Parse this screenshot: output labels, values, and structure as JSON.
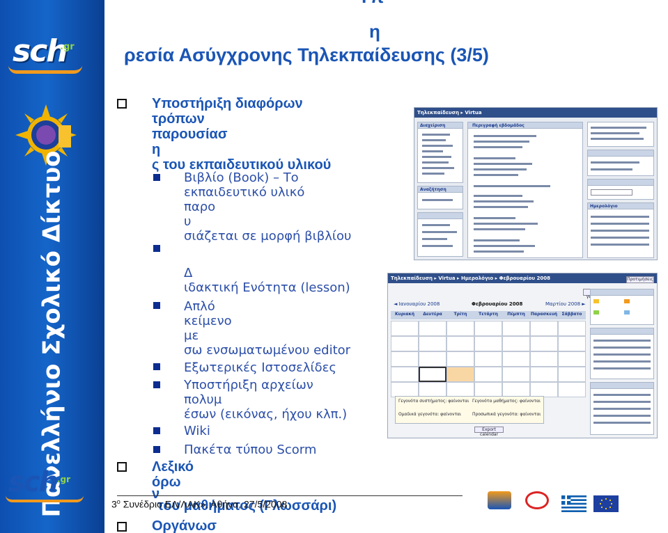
{
  "title": {
    "top": "Υπ",
    "mid": "η",
    "main": "ρεσία Ασύγχρονης Τηλεκπαίδευσης (3/5)"
  },
  "sidebar": {
    "logo": "sch",
    "logo_suffix": ".gr",
    "vertical_text": "Πανελλήνιο Σχολικό Δίκτυο"
  },
  "outline": [
    {
      "level": 1,
      "lines": [
        "Υποστήριξη διαφόρων",
        "τρόπων",
        "παρουσίασ",
        "η",
        "ς του εκπαιδευτικού υλικού"
      ]
    },
    {
      "level": 2,
      "lines": [
        "Βιβλίο (Book) – Το",
        "εκπαιδευτικό υλικό",
        "παρο",
        "υ",
        "σιάζεται σε μορφή βιβλίου"
      ]
    },
    {
      "level": 2,
      "lines": [
        "Δ",
        "ιδακτική Ενότητα (lesson)"
      ]
    },
    {
      "level": 2,
      "lines": [
        "Απλό",
        "κείμενο",
        "με",
        "σω ενσωματωμένου editor"
      ]
    },
    {
      "level": 2,
      "lines": [
        "Εξωτερικές Ιστοσελίδες"
      ]
    },
    {
      "level": 2,
      "lines": [
        "Υποστήριξη αρχείων",
        "πολυμ",
        "έσων (εικόνας, ήχου κλπ.)"
      ]
    },
    {
      "level": 2,
      "lines": [
        "Wiki"
      ]
    },
    {
      "level": 2,
      "lines": [
        "Πακέτα τύπου Scorm"
      ]
    },
    {
      "level": 1,
      "lines": [
        "Λεξικό",
        "όρω",
        "ν",
        "του μαθήματος (Γλωσσάρι)"
      ]
    },
    {
      "level": 1,
      "lines": [
        "Οργάνωσ"
      ]
    }
  ],
  "footer": {
    "num": "3",
    "sup": "ο",
    "text": " Συνέδριο ΕΛ/ΛΑΚ», Αθήνα, 27/5/2008"
  },
  "shot1": {
    "bar_title": "Τηλεκπαίδευση ▸ Virtua",
    "center_header": "Περιγραφή εβδομάδος",
    "block_admin": "Διαχείριση",
    "block_search": "Αναζήτηση",
    "block_calendar": "Ημερολόγιο"
  },
  "shot2": {
    "bar_title": "Τηλεκπαίδευση ▸ Virtua ▸ Ημερολόγιο ▸ Φεβρουαρίου 2008",
    "month_prev": "◄ Ιανουαρίου 2008",
    "month_current": "Φεβρουαρίου 2008",
    "month_next": "Μαρτίου 2008 ►",
    "new_event": "Νέο γεγονός",
    "preferences": "Προτιμήσεις",
    "days": [
      "Κυριακή",
      "Δευτέρα",
      "Τρίτη",
      "Τετάρτη",
      "Πέμπτη",
      "Παρασκευή",
      "Σάββατο"
    ],
    "legend": [
      "Γεγονότα συστήματος: φαίνονται",
      "Ομαδικά γεγονότα: φαίνονται",
      "Γεγονότα μαθήματος: φαίνονται",
      "Προσωπικά γεγονότα: φαίνονται"
    ],
    "export": "Export calendar"
  },
  "colors": {
    "accent": "#1a55b5",
    "sidebar": "#1565c9",
    "swoosh": "#f29a1d"
  }
}
